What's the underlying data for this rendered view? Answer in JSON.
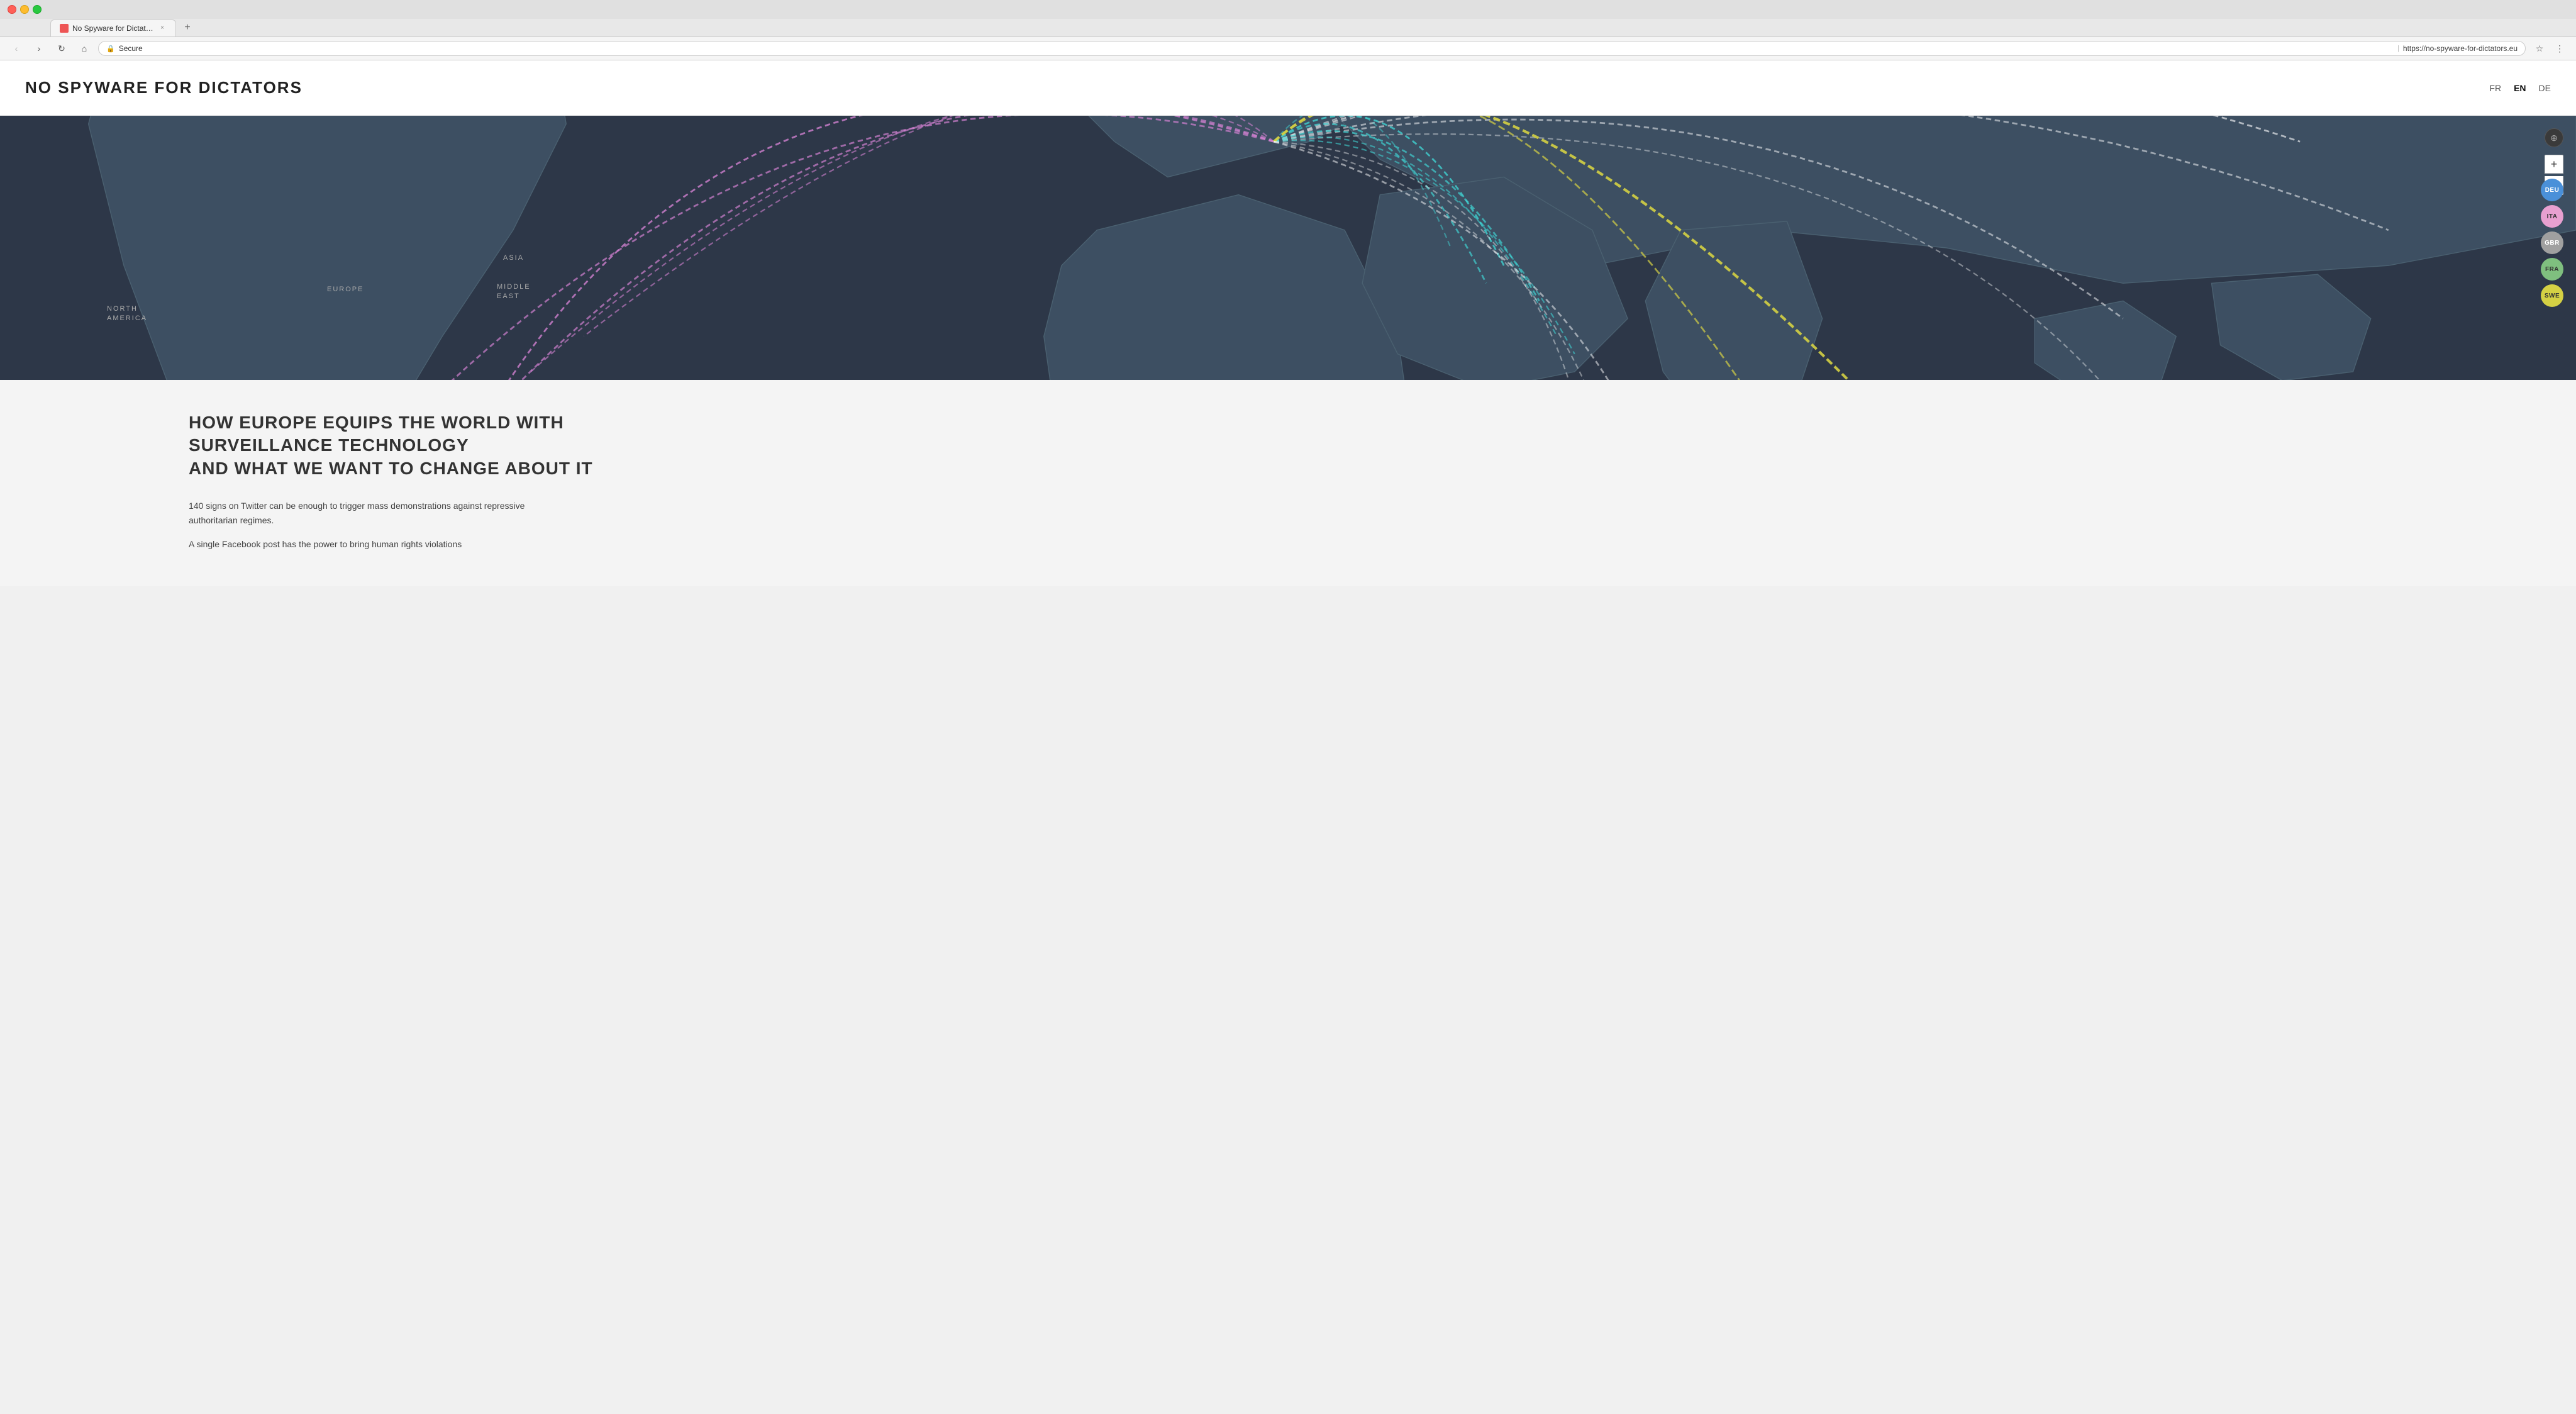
{
  "browser": {
    "tab_title": "No Spyware for Dictators",
    "tab_favicon_color": "#e55555",
    "address": "https://no-spyware-for-dictators.eu",
    "secure_label": "Secure",
    "new_tab_icon": "+",
    "close_icon": "×",
    "back_icon": "‹",
    "forward_icon": "›",
    "refresh_icon": "↻",
    "home_icon": "⌂",
    "star_icon": "☆",
    "menu_icon": "⋮",
    "extensions_icon": "⧉"
  },
  "site": {
    "title": "NO SPYWARE FOR DICTATORS",
    "nav": {
      "fr_label": "FR",
      "en_label": "EN",
      "de_label": "DE"
    }
  },
  "map": {
    "label_north_america": "NORTH\nAMERICA",
    "label_europe": "EUROPE",
    "label_asia": "ASIA",
    "label_middle_east": "MIDDLE\nEAST",
    "zoom_plus": "+",
    "zoom_minus": "−",
    "compass_icon": "⊕",
    "countries": [
      {
        "code": "DEU",
        "css_class": "badge-deu"
      },
      {
        "code": "ITA",
        "css_class": "badge-ita"
      },
      {
        "code": "GBR",
        "css_class": "badge-gbr"
      },
      {
        "code": "FRA",
        "css_class": "badge-fra"
      },
      {
        "code": "SWE",
        "css_class": "badge-swe"
      }
    ]
  },
  "content": {
    "heading_line1": "HOW EUROPE EQUIPS THE WORLD WITH",
    "heading_line2": "SURVEILLANCE TECHNOLOGY",
    "heading_line3": "AND WHAT WE WANT TO CHANGE ABOUT IT",
    "para1": "140 signs on Twitter can be enough to trigger mass demonstrations against repressive authoritarian regimes.",
    "para2": "A single Facebook post has the power to bring human rights violations"
  }
}
